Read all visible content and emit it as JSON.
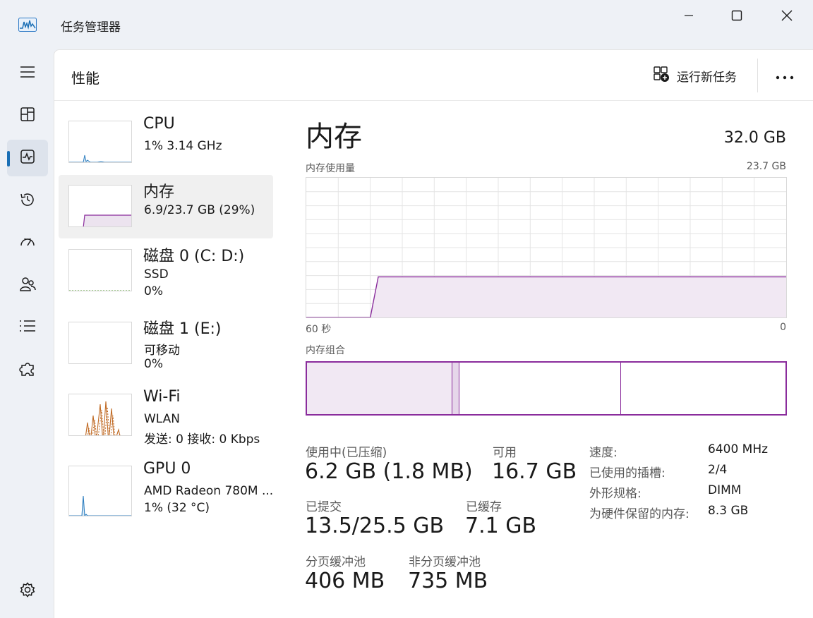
{
  "window": {
    "title": "任务管理器",
    "controls": {
      "minimize": "minimize-icon",
      "maximize": "maximize-icon",
      "close": "close-icon"
    }
  },
  "nav": {
    "items": [
      {
        "name": "menu",
        "icon": "hamburger-menu-icon"
      },
      {
        "name": "processes",
        "icon": "processes-grid-icon"
      },
      {
        "name": "performance",
        "icon": "performance-pulse-icon",
        "active": true
      },
      {
        "name": "app-history",
        "icon": "history-clock-icon"
      },
      {
        "name": "startup-apps",
        "icon": "speedometer-icon"
      },
      {
        "name": "users",
        "icon": "users-icon"
      },
      {
        "name": "details",
        "icon": "details-list-icon"
      },
      {
        "name": "services",
        "icon": "puzzle-piece-icon"
      }
    ],
    "settings_icon": "gear-icon"
  },
  "header": {
    "title": "性能",
    "run_new_task": "运行新任务",
    "more": "more-options-icon"
  },
  "devices": [
    {
      "name": "CPU",
      "line1": "1%  3.14 GHz",
      "line2": ""
    },
    {
      "name": "内存",
      "line1": "6.9/23.7 GB (29%)",
      "line2": "",
      "selected": true
    },
    {
      "name": "磁盘 0 (C: D:)",
      "line1": "SSD",
      "line2": "0%"
    },
    {
      "name": "磁盘 1 (E:)",
      "line1": "可移动",
      "line2": "0%"
    },
    {
      "name": "Wi-Fi",
      "line1": "WLAN",
      "line2": "发送: 0 接收: 0 Kbps"
    },
    {
      "name": "GPU 0",
      "line1": "AMD Radeon 780M ...",
      "line2": "1% (32 °C)"
    }
  ],
  "detail": {
    "title": "内存",
    "total": "32.0 GB",
    "usage_label": "内存使用量",
    "usage_max": "23.7 GB",
    "time_left": "60 秒",
    "time_right": "0",
    "composition_label": "内存组合",
    "stats": {
      "in_use_label": "使用中(已压缩)",
      "in_use_value": "6.2 GB (1.8 MB)",
      "available_label": "可用",
      "available_value": "16.7 GB",
      "committed_label": "已提交",
      "committed_value": "13.5/25.5 GB",
      "cached_label": "已缓存",
      "cached_value": "7.1 GB",
      "paged_label": "分页缓冲池",
      "paged_value": "406 MB",
      "nonpaged_label": "非分页缓冲池",
      "nonpaged_value": "735 MB"
    },
    "specs": [
      {
        "key": "速度:",
        "value": "6400 MHz"
      },
      {
        "key": "已使用的插槽:",
        "value": "2/4"
      },
      {
        "key": "外形规格:",
        "value": "DIMM"
      },
      {
        "key": "为硬件保留的内存:",
        "value": "8.3 GB"
      }
    ]
  },
  "chart_data": {
    "type": "area",
    "ylim": [
      0,
      23.7
    ],
    "x": [
      60,
      52,
      51,
      50,
      40,
      30,
      20,
      10,
      0
    ],
    "values": [
      0,
      0,
      6.9,
      6.9,
      6.9,
      6.9,
      6.9,
      6.9,
      6.9
    ],
    "composition": {
      "in_use": 6.2,
      "modified": 0.3,
      "standby": 6.9,
      "free": 7.0
    },
    "colors": {
      "line": "#8a2c9c",
      "fill": "#f1e8f3",
      "grid": "#e4e4e4"
    }
  }
}
